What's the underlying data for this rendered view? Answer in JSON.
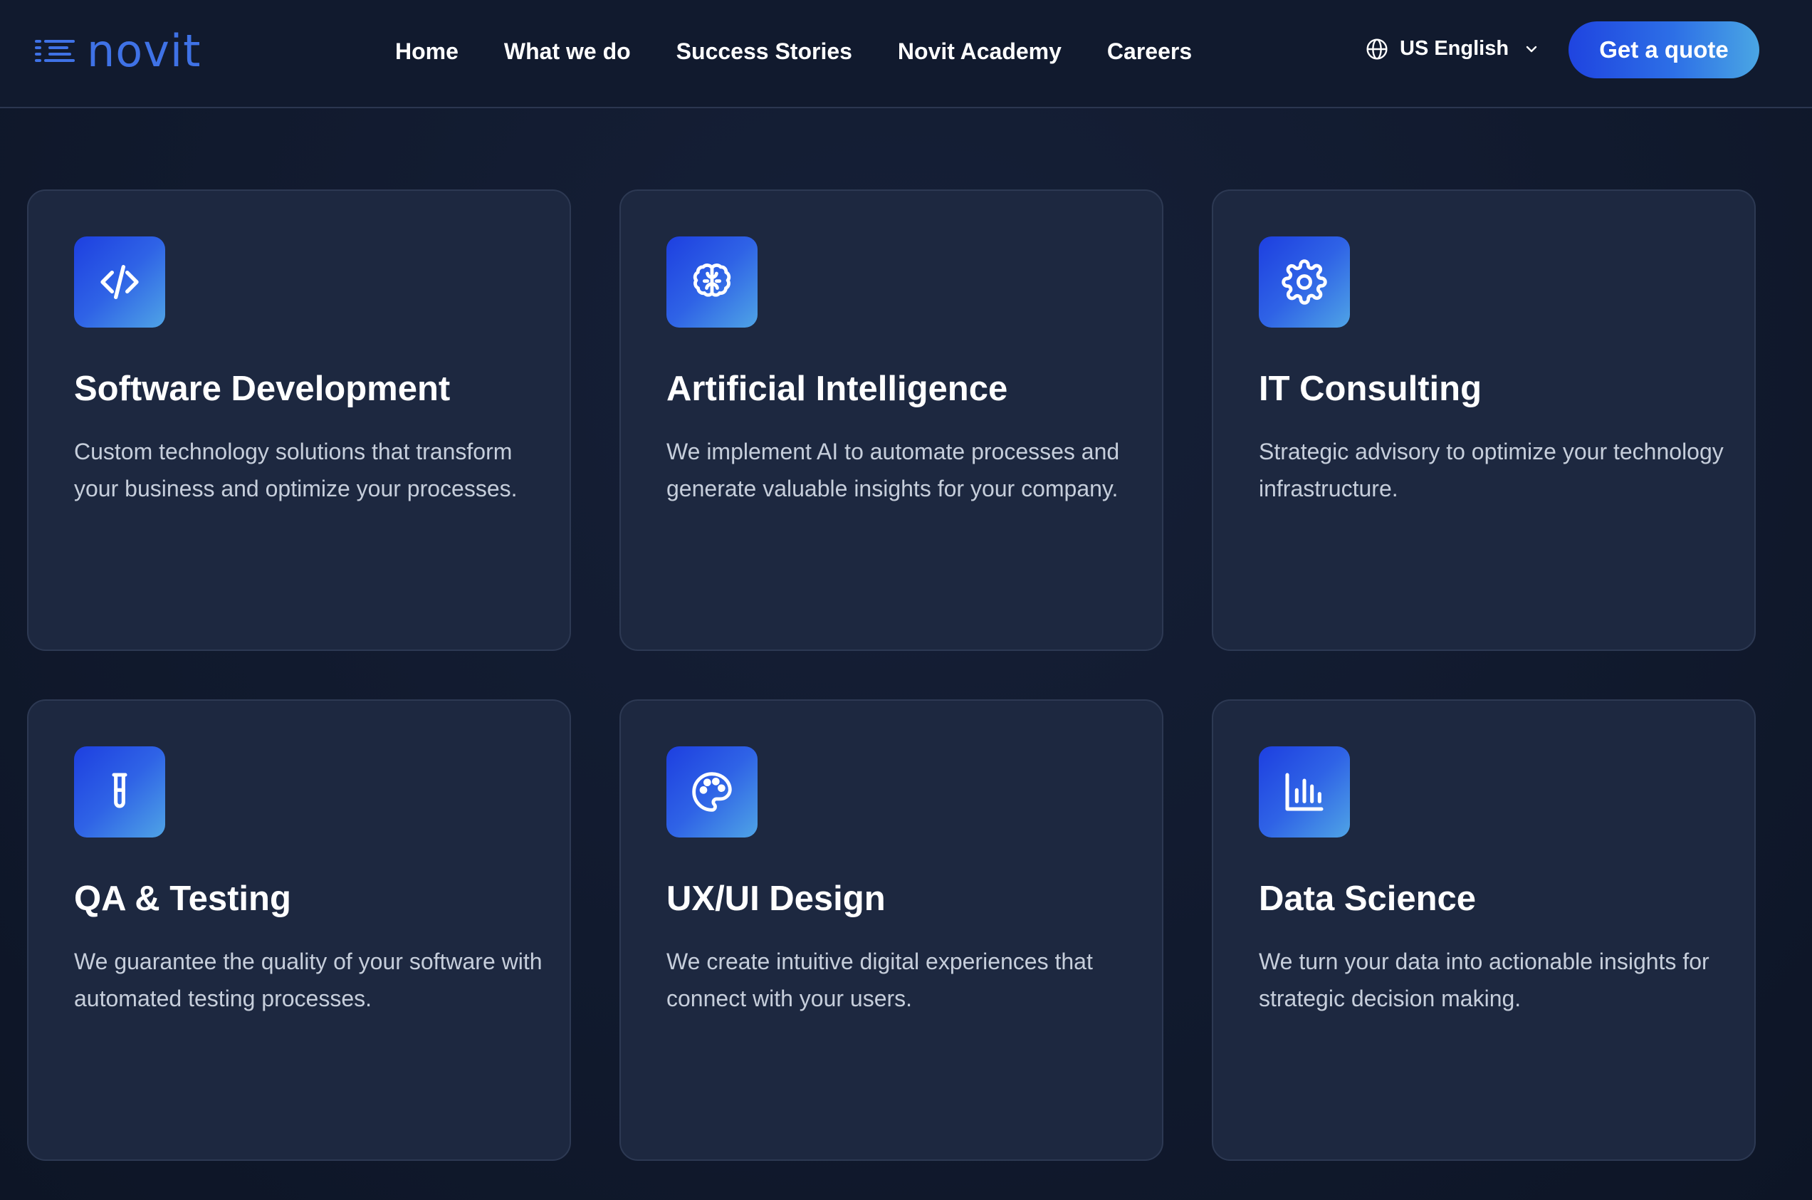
{
  "header": {
    "logo_text": "novit",
    "nav": [
      {
        "label": "Home"
      },
      {
        "label": "What we do"
      },
      {
        "label": "Success Stories"
      },
      {
        "label": "Novit Academy"
      },
      {
        "label": "Careers"
      }
    ],
    "language": {
      "label": "US English",
      "icon": "globe-icon"
    },
    "cta_label": "Get a quote"
  },
  "services": [
    {
      "icon": "code-icon",
      "title": "Software Development",
      "description": "Custom technology solutions that transform your business and optimize your processes."
    },
    {
      "icon": "brain-icon",
      "title": "Artificial Intelligence",
      "description": "We implement AI to automate processes and generate valuable insights for your company."
    },
    {
      "icon": "gear-icon",
      "title": "IT Consulting",
      "description": "Strategic advisory to optimize your technology infrastructure."
    },
    {
      "icon": "test-tube-icon",
      "title": "QA & Testing",
      "description": "We guarantee the quality of your software with automated testing processes."
    },
    {
      "icon": "palette-icon",
      "title": "UX/UI Design",
      "description": "We create intuitive digital experiences that connect with your users."
    },
    {
      "icon": "bar-chart-icon",
      "title": "Data Science",
      "description": "We turn your data into actionable insights for strategic decision making."
    }
  ],
  "colors": {
    "background": "#111a2e",
    "card": "#1d2840",
    "accent_start": "#1d3fe0",
    "accent_end": "#4fa4e6",
    "logo": "#3f72e6"
  }
}
